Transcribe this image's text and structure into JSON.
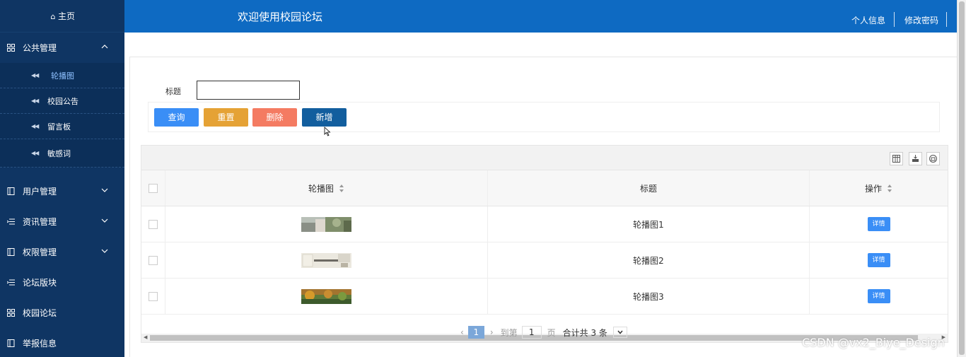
{
  "sidebar": {
    "home": "主页",
    "groups": [
      {
        "label": "公共管理"
      },
      {
        "label": "用户管理"
      },
      {
        "label": "资讯管理"
      },
      {
        "label": "权限管理"
      },
      {
        "label": "论坛版块"
      },
      {
        "label": "校园论坛"
      },
      {
        "label": "举报信息"
      }
    ],
    "public_sub": [
      {
        "label": "轮播图",
        "active": true
      },
      {
        "label": "校园公告"
      },
      {
        "label": "留言板"
      },
      {
        "label": "敏感词"
      }
    ]
  },
  "header": {
    "title": "欢迎使用校园论坛",
    "profile": "个人信息",
    "password": "修改密码"
  },
  "search": {
    "label": "标题",
    "value": ""
  },
  "buttons": {
    "query": "查询",
    "reset": "重置",
    "delete": "删除",
    "add": "新增"
  },
  "table": {
    "columns": [
      "轮播图",
      "标题",
      "操作"
    ],
    "rows": [
      {
        "title": "轮播图1",
        "action": "详情"
      },
      {
        "title": "轮播图2",
        "action": "详情"
      },
      {
        "title": "轮播图3",
        "action": "详情"
      }
    ]
  },
  "pager": {
    "current": "1",
    "goto_prefix": "到第",
    "goto_value": "1",
    "goto_suffix": "页",
    "total": "合计共 3 条"
  },
  "watermark": "CSDN @vx2_Biye_Design",
  "colors": {
    "sidebar": "#0f3563",
    "header": "#0e6ac2",
    "query": "#3a8ef6",
    "reset": "#e5a235",
    "delete": "#f47b62",
    "add": "#125e9e"
  }
}
